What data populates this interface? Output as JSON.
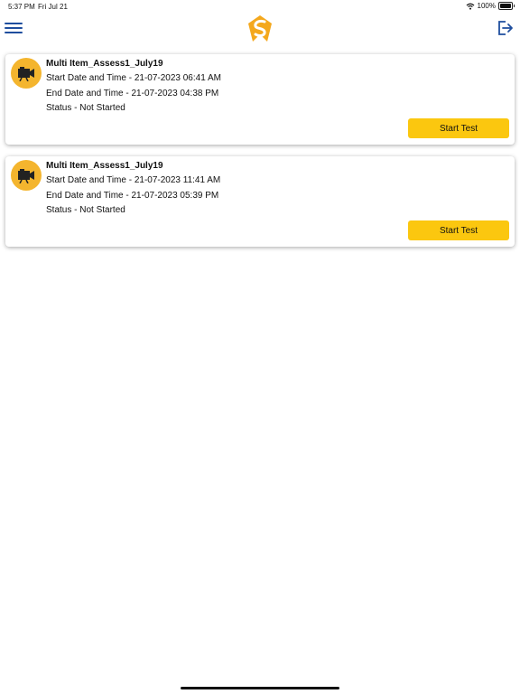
{
  "status_bar": {
    "time": "5:37 PM",
    "date": "Fri Jul 21",
    "battery": "100%",
    "battery_level": 1.0,
    "wifi_icon": "wifi-icon"
  },
  "nav": {
    "menu_icon": "hamburger-menu-icon",
    "logo_icon": "app-logo",
    "logout_icon": "logout-icon"
  },
  "colors": {
    "accent": "#fbc70f",
    "avatar_bg": "#f4b52e",
    "nav_icon": "#1f4e9e"
  },
  "assessments": [
    {
      "title": "Multi Item_Assess1_July19",
      "start": "Start Date and Time - 21-07-2023 06:41 AM",
      "end": "End Date and Time - 21-07-2023 04:38 PM",
      "status": "Status - Not Started",
      "button": "Start Test",
      "icon": "video-camera-icon"
    },
    {
      "title": "Multi Item_Assess1_July19",
      "start": "Start Date and Time - 21-07-2023 11:41 AM",
      "end": "End Date and Time - 21-07-2023 05:39 PM",
      "status": "Status - Not Started",
      "button": "Start Test",
      "icon": "video-camera-icon"
    }
  ]
}
